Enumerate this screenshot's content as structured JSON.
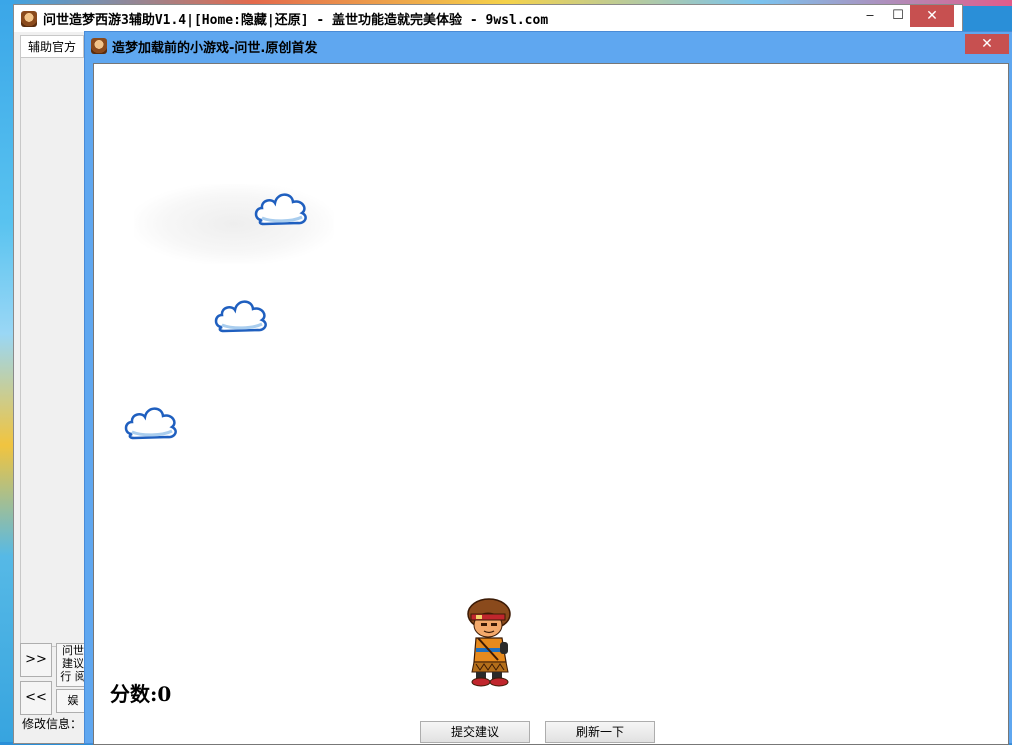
{
  "outer_window": {
    "title": "问世造梦西游3辅助V1.4|[Home:隐藏|还原] - 盖世功能造就完美体验 - 9wsl.com",
    "minimize": "‒",
    "maximize": "☐",
    "close": "✕"
  },
  "sidebar": {
    "tab_label": "辅助官方",
    "expand_button": ">>",
    "collapse_button": "<<",
    "side_button_1": "问世 建议行 阅",
    "side_button_2": "娱",
    "modify_info_label": "修改信息："
  },
  "game_window": {
    "title": "造梦加载前的小游戏-问世.原创首发",
    "close": "✕",
    "score_label": "分数:0",
    "submit_button": "提交建议",
    "refresh_button": "刷新一下"
  },
  "colors": {
    "inner_titlebar": "#5fa7f0",
    "close_button": "#c75050",
    "cloud_outline": "#1f5fbf"
  },
  "icons": {
    "app_icon": "monkey-king-face",
    "cloud": "cloud-sprite",
    "hero": "hero-character-sprite"
  }
}
